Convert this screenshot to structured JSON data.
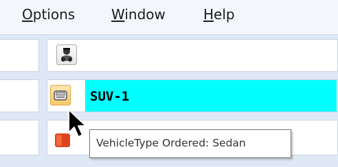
{
  "menu": {
    "items": [
      {
        "mnemonic": "O",
        "rest": "ptions"
      },
      {
        "mnemonic": "W",
        "rest": "indow"
      },
      {
        "mnemonic": "H",
        "rest": "elp"
      }
    ]
  },
  "grid": {
    "rows": [
      {
        "icon": "driver-icon",
        "label": ""
      },
      {
        "icon": "car-icon",
        "label": "SUV-1",
        "selected": true,
        "highlight_color": "#00ffff"
      },
      {
        "icon": "vehicle-red-icon",
        "label": ""
      }
    ]
  },
  "tooltip": {
    "text": "VehicleType Ordered: Sedan"
  }
}
